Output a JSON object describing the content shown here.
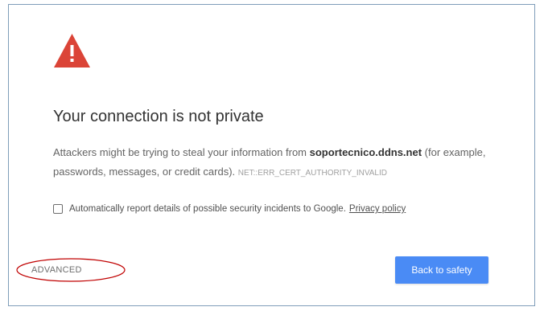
{
  "interstitial": {
    "title": "Your connection is not private",
    "desc_prefix": "Attackers might be trying to steal your information from ",
    "host": "soportecnico.ddns.net",
    "desc_suffix": " (for example, passwords, messages, or credit cards). ",
    "error_code": "NET::ERR_CERT_AUTHORITY_INVALID",
    "report_label": "Automatically report details of possible security incidents to Google.",
    "privacy_link": "Privacy policy",
    "report_checked": false,
    "advanced_label": "ADVANCED",
    "back_button_label": "Back to safety"
  },
  "colors": {
    "warning_icon": "#db4437",
    "back_button": "#4a8bf5",
    "annotation_ellipse": "#c00000"
  },
  "icons": {
    "warning": "warning-triangle-icon"
  }
}
